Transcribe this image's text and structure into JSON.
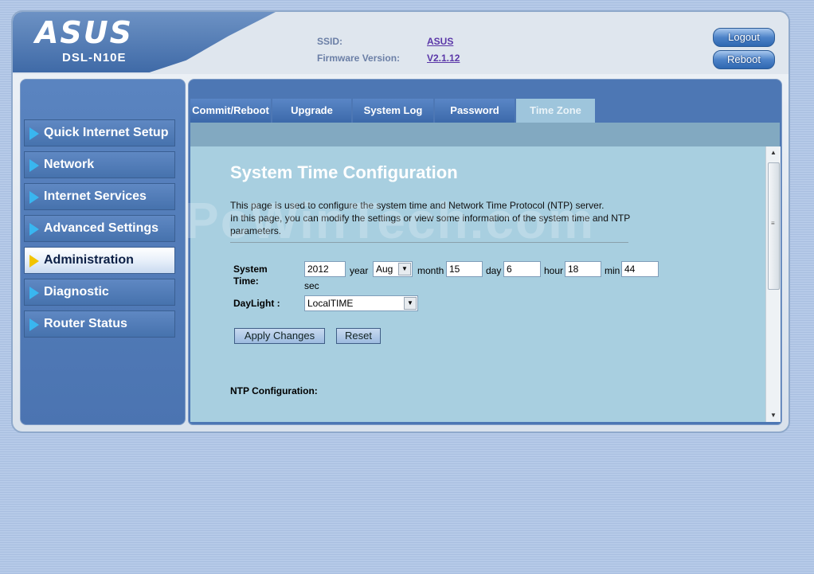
{
  "brand": {
    "logo": "ASUS",
    "model": "DSL-N10E"
  },
  "info": {
    "ssid_label": "SSID:",
    "ssid_value": "ASUS",
    "firmware_label": "Firmware Version:",
    "firmware_value": "V2.1.12"
  },
  "top_buttons": {
    "logout": "Logout",
    "reboot": "Reboot"
  },
  "sidebar": {
    "items": [
      {
        "label": "Quick Internet Setup",
        "active": false
      },
      {
        "label": "Network",
        "active": false
      },
      {
        "label": "Internet Services",
        "active": false
      },
      {
        "label": "Advanced Settings",
        "active": false
      },
      {
        "label": "Administration",
        "active": true
      },
      {
        "label": "Diagnostic",
        "active": false
      },
      {
        "label": "Router Status",
        "active": false
      }
    ]
  },
  "tabs": [
    {
      "label": "Commit/Reboot",
      "active": false
    },
    {
      "label": "Upgrade",
      "active": false
    },
    {
      "label": "System Log",
      "active": false
    },
    {
      "label": "Password",
      "active": false
    },
    {
      "label": "Time Zone",
      "active": true
    }
  ],
  "page": {
    "title": "System Time Configuration",
    "desc_line1": "This page is used to configure the system time and Network Time Protocol (NTP) server.",
    "desc_line2": "In this page, you can modify the settings or view some information of the system time and NTP parameters.",
    "system_time_label": "System Time:",
    "year_value": "2012",
    "year_unit": "year",
    "month_value": "Aug",
    "month_unit": "month",
    "day_value": "15",
    "day_unit": "day",
    "hour_value": "6",
    "hour_unit": "hour",
    "min_value": "18",
    "min_unit": "min",
    "sec_value": "44",
    "sec_unit": "sec",
    "daylight_label": "DayLight :",
    "daylight_value": "LocalTIME",
    "apply_button": "Apply Changes",
    "reset_button": "Reset",
    "ntp_title": "NTP Configuration:"
  },
  "watermark": "PcWinTech.com",
  "colors": {
    "accent": "#4d77b4",
    "content_bg": "#a8cfe0",
    "active_tab": "#9ec5dc",
    "active_arrow": "#f2c400",
    "arrow": "#39b6f0"
  }
}
